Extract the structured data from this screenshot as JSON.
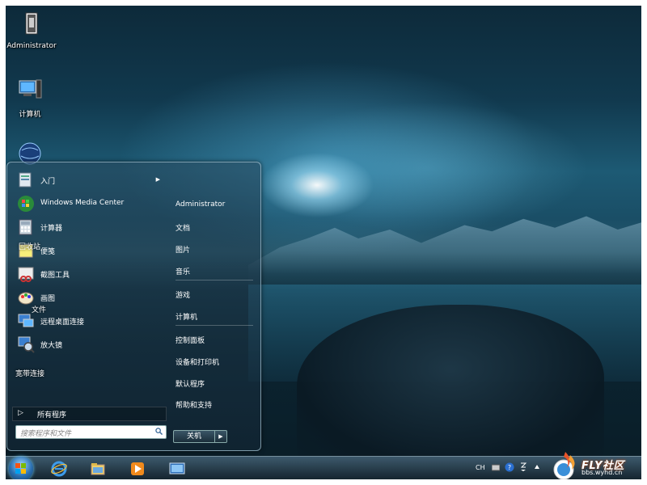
{
  "desktop": {
    "icons": [
      {
        "label": "Administrator",
        "icon": "user-folder-icon"
      },
      {
        "label": "计算机",
        "icon": "computer-icon"
      },
      {
        "label": "网络",
        "icon": "network-globe-icon"
      },
      {
        "label": "回收站",
        "icon": "recycle-bin-icon"
      },
      {
        "label": "文件",
        "icon": "folder-icon"
      },
      {
        "label": "宽带连接",
        "icon": "broadband-connection-icon"
      }
    ]
  },
  "start_menu": {
    "programs": [
      {
        "label": "入门",
        "icon": "getting-started-icon",
        "has_arrow": true
      },
      {
        "label": "Windows Media Center",
        "icon": "media-center-icon",
        "has_arrow": false
      },
      {
        "label": "计算器",
        "icon": "calculator-icon",
        "has_arrow": false
      },
      {
        "label": "便笺",
        "icon": "sticky-notes-icon",
        "has_arrow": false
      },
      {
        "label": "截图工具",
        "icon": "snipping-tool-icon",
        "has_arrow": false
      },
      {
        "label": "画图",
        "icon": "paint-icon",
        "has_arrow": false
      },
      {
        "label": "远程桌面连接",
        "icon": "remote-desktop-icon",
        "has_arrow": false
      },
      {
        "label": "放大镜",
        "icon": "magnifier-icon",
        "has_arrow": false
      }
    ],
    "right_items": [
      "Administrator",
      "文档",
      "图片",
      "音乐",
      "游戏",
      "计算机",
      "控制面板",
      "设备和打印机",
      "默认程序",
      "帮助和支持"
    ],
    "all_programs_label": "所有程序",
    "search_placeholder": "搜索程序和文件",
    "shutdown_label": "关机"
  },
  "taskbar": {
    "pinned": [
      {
        "name": "internet-explorer-icon"
      },
      {
        "name": "windows-explorer-icon"
      },
      {
        "name": "media-player-icon"
      },
      {
        "name": "remote-desktop-icon"
      }
    ],
    "tray": {
      "language": "CH"
    }
  },
  "watermark": {
    "brand": "FLY社区",
    "url": "bbs.wyhd.cn"
  },
  "colors": {
    "accent": "#2a6fb0",
    "menu_border": "#aac8d7"
  }
}
